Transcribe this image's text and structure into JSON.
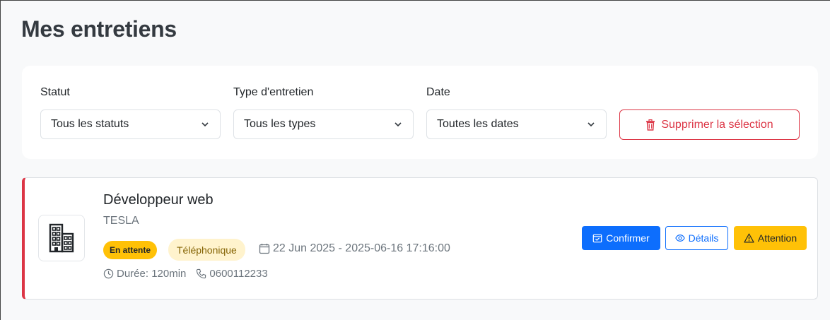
{
  "page": {
    "title": "Mes entretiens"
  },
  "filters": {
    "status": {
      "label": "Statut",
      "value": "Tous les statuts"
    },
    "type": {
      "label": "Type d'entretien",
      "value": "Tous les types"
    },
    "date": {
      "label": "Date",
      "value": "Toutes les dates"
    },
    "delete_label": "Supprimer la sélection"
  },
  "interview": {
    "job_title": "Développeur web",
    "company": "TESLA",
    "status_badge": "En attente",
    "type_badge": "Téléphonique",
    "date_text": "22 Jun 2025 - 2025-06-16 17:16:00",
    "duration_text": "Durée: 120min",
    "phone_text": "0600112233",
    "actions": {
      "confirm_label": "Confirmer",
      "details_label": "Détails",
      "attention_label": "Attention"
    }
  },
  "colors": {
    "primary": "#0d6efd",
    "danger": "#dc3545",
    "warning": "#ffc107",
    "warning_light": "#fff3cd"
  }
}
